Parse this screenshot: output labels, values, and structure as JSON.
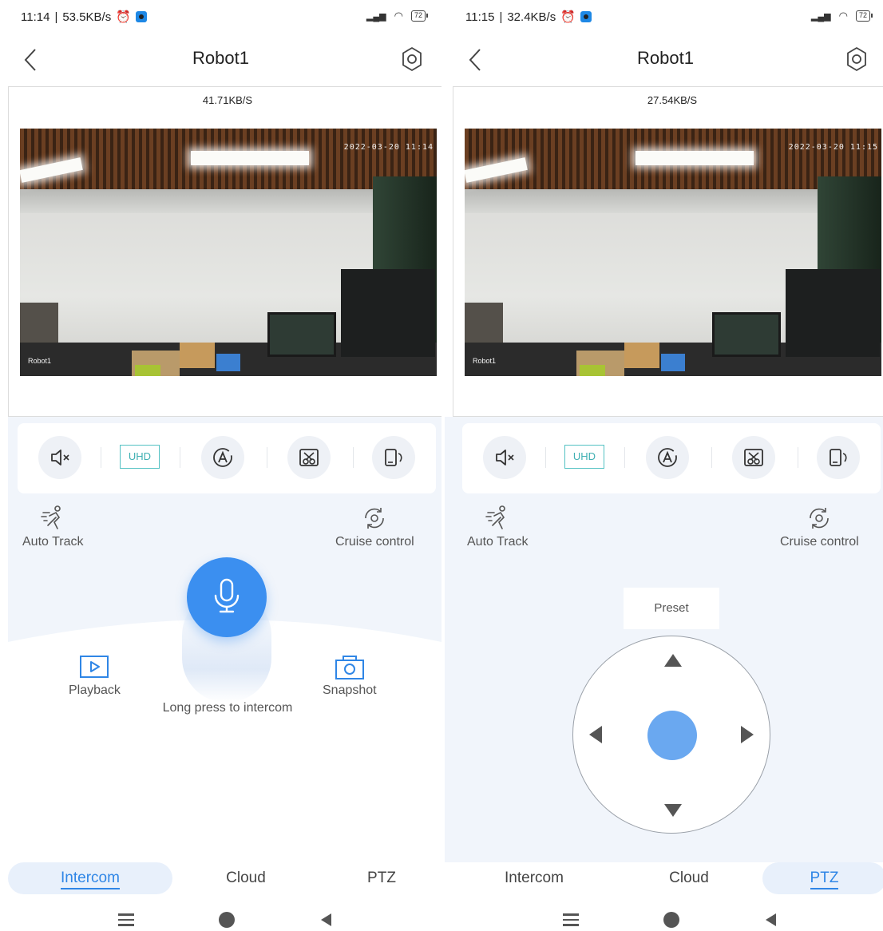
{
  "screens": [
    {
      "status": {
        "time": "11:14",
        "speed": "53.5KB/s",
        "signal": "⁴ᴳ▴ıl",
        "battery": "72"
      },
      "header": {
        "title": "Robot1"
      },
      "video": {
        "bitrate": "41.71KB/S",
        "timestamp": "2022-03-20 11:14",
        "camera_name": "Robot1"
      },
      "toolbar": {
        "uhd_label": "UHD"
      },
      "features": {
        "auto_track": "Auto Track",
        "cruise_control": "Cruise control"
      },
      "intercom": {
        "playback": "Playback",
        "snapshot": "Snapshot",
        "long_press": "Long press to intercom"
      },
      "tabs": [
        "Intercom",
        "Cloud",
        "PTZ"
      ],
      "active_tab": "Intercom"
    },
    {
      "status": {
        "time": "11:15",
        "speed": "32.4KB/s",
        "signal": "⁴ᴳ▴ıl",
        "battery": "72"
      },
      "header": {
        "title": "Robot1"
      },
      "video": {
        "bitrate": "27.54KB/S",
        "timestamp": "2022-03-20 11:15",
        "camera_name": "Robot1"
      },
      "toolbar": {
        "uhd_label": "UHD"
      },
      "features": {
        "auto_track": "Auto Track",
        "cruise_control": "Cruise control"
      },
      "ptz": {
        "preset": "Preset"
      },
      "tabs": [
        "Intercom",
        "Cloud",
        "PTZ"
      ],
      "active_tab": "PTZ"
    }
  ],
  "icons": {
    "back": "chevron-left-icon",
    "settings": "settings-gear-icon",
    "mute": "speaker-muted-icon",
    "auto": "auto-mode-icon",
    "crop": "scissors-icon",
    "rotate": "phone-rotate-icon",
    "auto_track": "running-person-icon",
    "cruise": "cruise-rotate-icon",
    "mic": "microphone-icon",
    "playback": "play-icon",
    "snapshot": "camera-icon"
  },
  "colors": {
    "accent": "#2f86e6",
    "mic": "#3b8ff0",
    "uhd": "#3fb0b3",
    "panel_bg": "#f1f5fb"
  }
}
